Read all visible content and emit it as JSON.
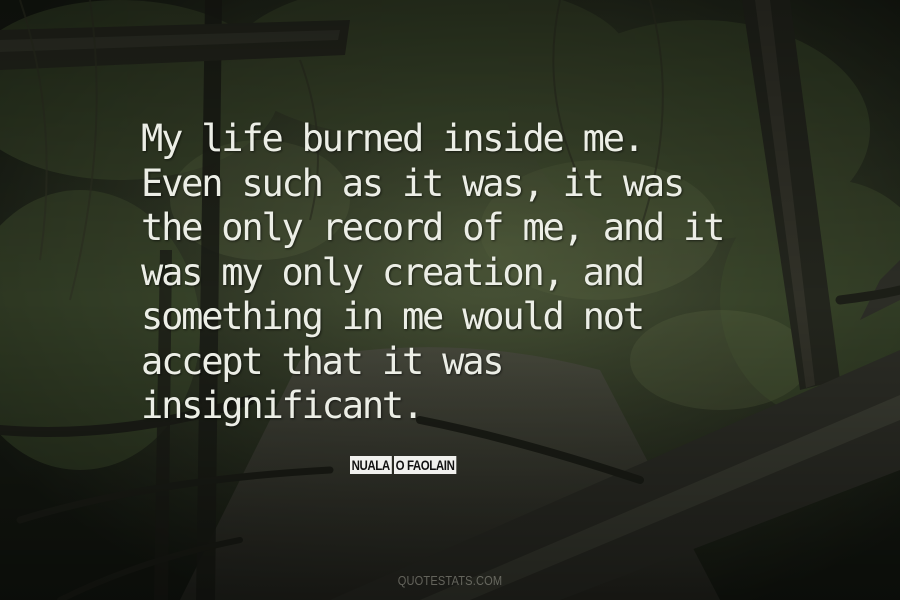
{
  "quote": {
    "lines": [
      "My life burned inside me.",
      "Even such as it was, it was",
      "the only record of me, and it",
      "was my only creation, and",
      "something in me would not",
      "accept that it was",
      "insignificant."
    ]
  },
  "author": {
    "first": "NUALA",
    "last": "O FAOLAIN"
  },
  "watermark": {
    "text": "QUOTESTATS.COM"
  },
  "colors": {
    "quote_text": "#eceee6",
    "background_dark": "#1f2419",
    "foliage": "#3d4a2c",
    "author_label_bg": "#f1f1ee"
  }
}
